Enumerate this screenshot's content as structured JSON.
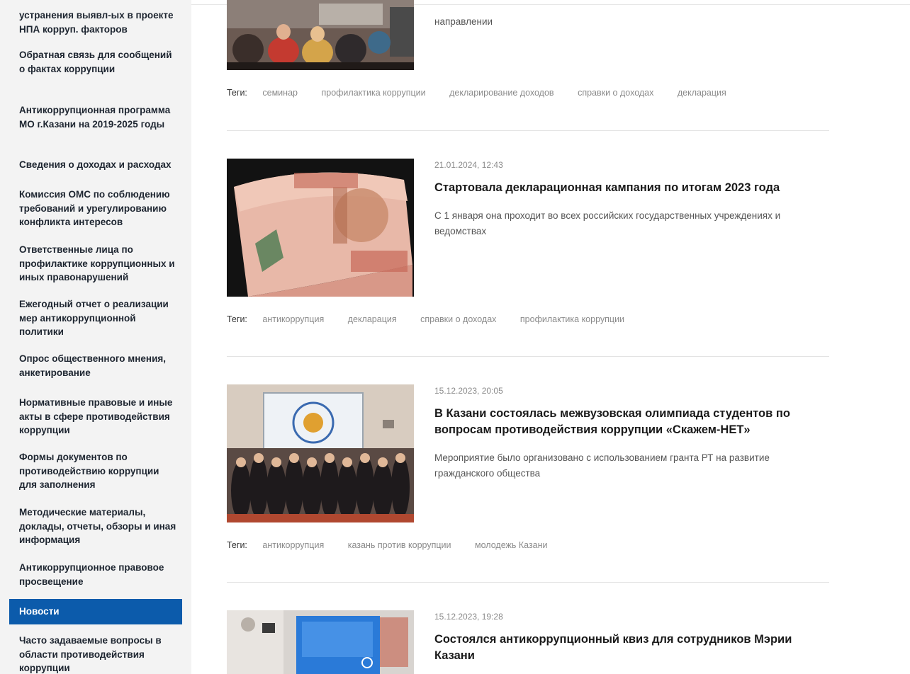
{
  "sidebar": {
    "items": [
      {
        "label": "устранения выявл-ых в проекте НПА корруп. факторов"
      },
      {
        "label": "Обратная связь для сообщений о фактах коррупции"
      },
      {
        "label": "Антикоррупционная программа МО г.Казани на 2019-2025 годы"
      },
      {
        "label": "Сведения о доходах и расходах"
      },
      {
        "label": "Комиссия ОМС по соблюдению требований и урегулированию конфликта интересов"
      },
      {
        "label": "Ответственные лица по профилактике коррупционных и иных правонарушений"
      },
      {
        "label": "Ежегодный отчет о реализации мер антикоррупционной политики"
      },
      {
        "label": "Опрос общественного мнения, анкетирование"
      },
      {
        "label": "Нормативные правовые и иные акты в сфере противодействия коррупции"
      },
      {
        "label": "Формы документов по противодействию коррупции для заполнения"
      },
      {
        "label": "Методические материалы, доклады, отчеты, обзоры и иная информация"
      },
      {
        "label": "Антикоррупционное правовое просвещение"
      },
      {
        "label": "Новости"
      },
      {
        "label": "Часто задаваемые вопросы в области противодействия коррупции"
      }
    ]
  },
  "tags_label": "Теги:",
  "news": [
    {
      "title": "",
      "date": "",
      "desc": "направлении",
      "tags": [
        "семинар",
        "профилактика коррупции",
        "декларирование доходов",
        "справки о доходах",
        "декларация"
      ]
    },
    {
      "date": "21.01.2024, 12:43",
      "title": "Стартовала декларационная кампания по итогам 2023 года",
      "desc": "С 1 января она проходит во всех российских государственных учреждениях и ведомствах",
      "tags": [
        "антикоррупция",
        "декларация",
        "справки о доходах",
        "профилактика коррупции"
      ]
    },
    {
      "date": "15.12.2023, 20:05",
      "title": "В Казани состоялась межвузовская олимпиада студентов по вопросам противодействия коррупции «Скажем-НЕТ»",
      "desc": "Мероприятие было организовано с использованием гранта РТ на развитие гражданского общества",
      "tags": [
        "антикоррупция",
        "казань против коррупции",
        "молодежь Казани"
      ]
    },
    {
      "date": "15.12.2023, 19:28",
      "title": "Состоялся антикоррупционный квиз для сотрудников Мэрии Казани",
      "desc": "",
      "tags": []
    }
  ],
  "colors": {
    "accent": "#0c5bab",
    "sidebar_bg": "#f3f3f3",
    "muted": "#8a8a8a"
  }
}
